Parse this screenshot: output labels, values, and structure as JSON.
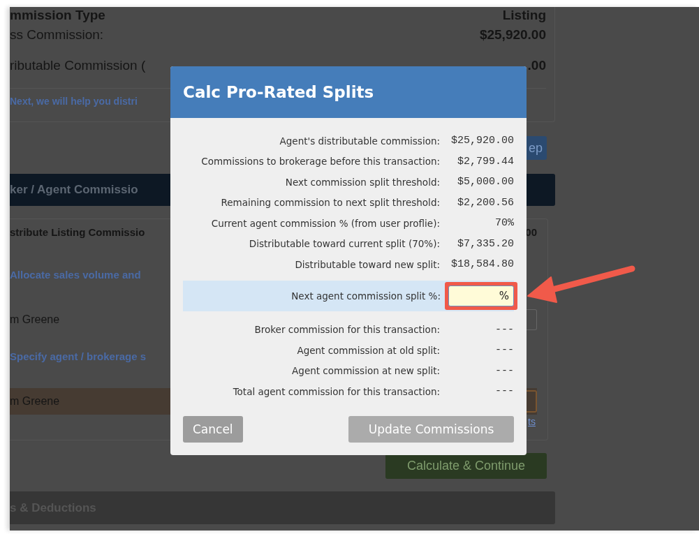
{
  "page": {
    "summary_rows": [
      {
        "label": "mmission Type",
        "value": "Listing"
      },
      {
        "label": "ss Commission:",
        "value": "$25,920.00"
      },
      {
        "label": "ributable Commission (",
        "value": ".00"
      }
    ],
    "note": "Next, we will help you distri",
    "step_button": "ep",
    "section_header": "ker / Agent Commissio",
    "distribute_card": {
      "title": "stribute Listing Commissio",
      "amount": "00",
      "rows": [
        {
          "kind": "heading",
          "text": "Allocate sales volume and"
        },
        {
          "kind": "agent",
          "text": "m Greene",
          "highlighted": false
        },
        {
          "kind": "heading",
          "text": "Specify agent / brokerage s"
        },
        {
          "kind": "agent",
          "text": "m Greene",
          "highlighted": true
        },
        {
          "kind": "link",
          "text": "ts"
        }
      ]
    },
    "continue_button": "Calculate & Continue",
    "deductions_header": "s & Deductions"
  },
  "modal": {
    "title": "Calc Pro-Rated Splits",
    "stats": [
      {
        "label": "Agent's distributable commission:",
        "value": "$25,920.00"
      },
      {
        "label": "Commissions to brokerage before this transaction:",
        "value": "$2,799.44"
      },
      {
        "label": "Next commission split threshold:",
        "value": "$5,000.00"
      },
      {
        "label": "Remaining commission to next split threshold:",
        "value": "$2,200.56"
      },
      {
        "label": "Current agent commission % (from user proflie):",
        "value": "70%"
      },
      {
        "label": "Distributable toward current split (70%):",
        "value": "$7,335.20"
      },
      {
        "label": "Distributable toward new split:",
        "value": "$18,584.80"
      }
    ],
    "split_input": {
      "label": "Next agent commission split %:",
      "value": "%",
      "highlighted": true
    },
    "results": [
      {
        "label": "Broker commission for this transaction:",
        "value": "---"
      },
      {
        "label": "Agent commission at old split:",
        "value": "---"
      },
      {
        "label": "Agent commission at new split:",
        "value": "---"
      },
      {
        "label": "Total agent commission for this transaction:",
        "value": "---"
      }
    ],
    "buttons": [
      {
        "label": "Cancel",
        "disabled": false
      },
      {
        "label": "Update Commissions",
        "disabled": true
      }
    ]
  }
}
